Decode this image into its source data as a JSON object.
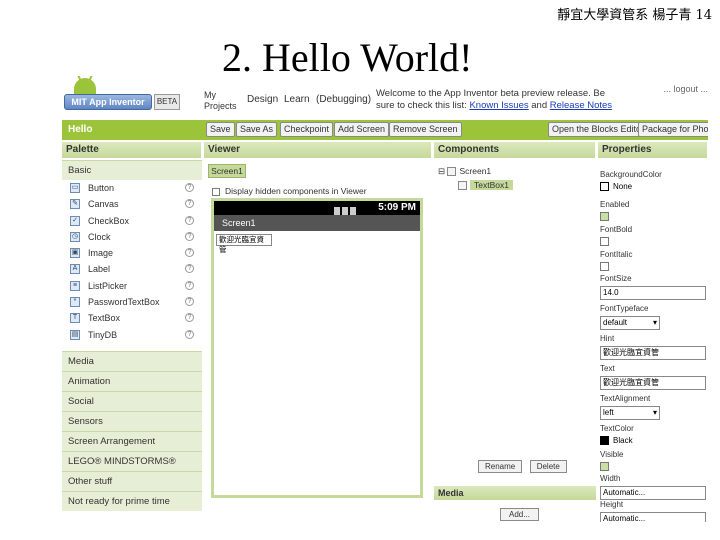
{
  "slide": {
    "header": "靜宜大學資管系 楊子青 14",
    "title": "2. Hello World!"
  },
  "topbar": {
    "logo_text": "MIT App Inventor",
    "beta_label": "BETA",
    "nav": [
      "My Projects",
      "Design",
      "Learn",
      "(Debugging)"
    ],
    "welcome_pre": "Welcome to the App Inventor beta preview release. Be sure to check this list:",
    "welcome_link1": "Known Issues",
    "welcome_mid": "and",
    "welcome_link2": "Release Notes",
    "account": "... logout ..."
  },
  "projbar": {
    "project_name": "Hello",
    "buttons_left": [
      "Save",
      "Save As",
      "Checkpoint",
      "Add Screen",
      "Remove Screen"
    ],
    "buttons_right": [
      "Open the Blocks Editor",
      "Package for Phone"
    ]
  },
  "columns": {
    "palette": "Palette",
    "viewer": "Viewer",
    "components": "Components",
    "properties": "Properties"
  },
  "palette": {
    "basic_section": "Basic",
    "items": [
      {
        "label": "Button",
        "icon": "button-icon"
      },
      {
        "label": "Canvas",
        "icon": "canvas-icon"
      },
      {
        "label": "CheckBox",
        "icon": "checkbox-icon"
      },
      {
        "label": "Clock",
        "icon": "clock-icon"
      },
      {
        "label": "Image",
        "icon": "image-icon"
      },
      {
        "label": "Label",
        "icon": "label-icon"
      },
      {
        "label": "ListPicker",
        "icon": "listpicker-icon"
      },
      {
        "label": "PasswordTextBox",
        "icon": "passwordtextbox-icon"
      },
      {
        "label": "TextBox",
        "icon": "textbox-icon"
      },
      {
        "label": "TinyDB",
        "icon": "tinydb-icon"
      }
    ],
    "help_glyph": "?",
    "sections": [
      "Media",
      "Animation",
      "Social",
      "Sensors",
      "Screen Arrangement",
      "LEGO® MINDSTORMS®",
      "Other stuff",
      "Not ready for prime time"
    ]
  },
  "viewer": {
    "screen_tab": "Screen1",
    "hidden_checkbox_label": "Display hidden components in Viewer",
    "status_time": "5:09 PM",
    "screen_title": "Screen1",
    "textbox_value": "歡迎光臨宜資管"
  },
  "components": {
    "root": "Screen1",
    "child": "TextBox1",
    "rename_button": "Rename",
    "delete_button": "Delete",
    "media_header": "Media",
    "add_button": "Add..."
  },
  "properties": {
    "items": [
      {
        "label": "BackgroundColor",
        "kind": "swatch",
        "value": "None",
        "color": "#ffffff"
      },
      {
        "label": "Enabled",
        "kind": "check",
        "checked": true
      },
      {
        "label": "FontBold",
        "kind": "check",
        "checked": false
      },
      {
        "label": "FontItalic",
        "kind": "check",
        "checked": false
      },
      {
        "label": "FontSize",
        "kind": "text",
        "value": "14.0"
      },
      {
        "label": "FontTypeface",
        "kind": "dropdown",
        "value": "default"
      },
      {
        "label": "Hint",
        "kind": "text",
        "value": "歡迎光臨宜資管"
      },
      {
        "label": "Text",
        "kind": "text",
        "value": "歡迎光臨宜資管"
      },
      {
        "label": "TextAlignment",
        "kind": "dropdown",
        "value": "left"
      },
      {
        "label": "TextColor",
        "kind": "swatch",
        "value": "Black",
        "color": "#000000"
      },
      {
        "label": "Visible",
        "kind": "check",
        "checked": true
      },
      {
        "label": "Width",
        "kind": "text",
        "value": "Automatic..."
      },
      {
        "label": "Height",
        "kind": "text",
        "value": "Automatic..."
      }
    ]
  },
  "colors": {
    "accent_green": "#9bc43b",
    "header_green": "#c5d99a"
  }
}
